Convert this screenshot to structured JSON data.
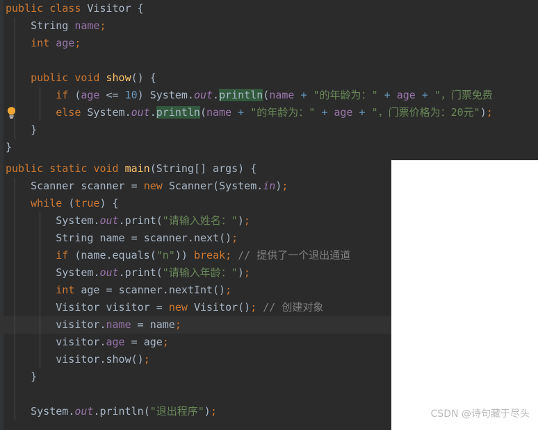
{
  "colors": {
    "editor_background": "#2b2b2b",
    "gutter_background": "#313335",
    "default_text": "#a9b7c6",
    "keyword": "#cc7832",
    "string": "#6a8759",
    "number": "#6897bb",
    "comment": "#808080",
    "field": "#9876aa",
    "method_declaration": "#ffc66d",
    "search_highlight": "#32593d",
    "current_line": "#323232",
    "page_background": "#ffffff",
    "watermark_text": "#b9b9b9"
  },
  "editor": {
    "language": "Java",
    "top_panel": {
      "lines": [
        "public class Visitor {",
        "    String name;",
        "    int age;",
        "",
        "    public void show() {",
        "        if (age <= 10) System.out.println(name + \"的年龄为：\" + age + \"，门票免费",
        "        else System.out.println(name + \"的年龄为：\" + age + \"，门票价格为：20元\");",
        "    }",
        "}"
      ],
      "gutter_icon": "lightbulb-icon",
      "gutter_icon_line": 7,
      "search_highlight_token": "println"
    },
    "bottom_panel": {
      "lines": [
        "public static void main(String[] args) {",
        "    Scanner scanner = new Scanner(System.in);",
        "    while (true) {",
        "        System.out.print(\"请输入姓名：\");",
        "        String name = scanner.next();",
        "        if (name.equals(\"n\")) break; // 提供了一个退出通道",
        "        System.out.print(\"请输入年龄：\");",
        "        int age = scanner.nextInt();",
        "        Visitor visitor = new Visitor(); // 创建对象",
        "        visitor.name = name;",
        "        visitor.age = age;",
        "        visitor.show();",
        "    }",
        "",
        "    System.out.println(\"退出程序\");"
      ],
      "current_line_index": 9,
      "comments": [
        "// 提供了一个退出通道",
        "// 创建对象"
      ]
    }
  },
  "watermark": {
    "text": "CSDN @诗句藏于尽头"
  }
}
